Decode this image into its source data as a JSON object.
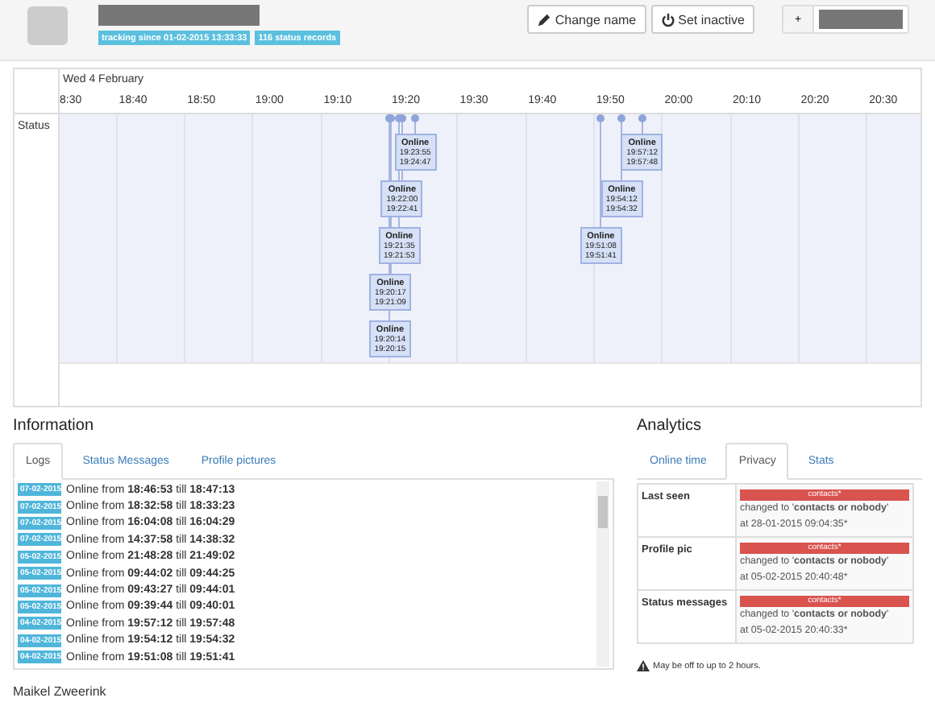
{
  "profile": {
    "badges": [
      "tracking since 01-02-2015 13:33:33",
      "116 status records"
    ],
    "buttons": [
      {
        "kind": "pencil",
        "label": "Change name"
      },
      {
        "kind": "power",
        "label": "Set inactive"
      }
    ],
    "add_button": "+"
  },
  "timeline": {
    "date": "Wed 4 February",
    "ticks": [
      "8:30",
      "18:40",
      "18:50",
      "19:00",
      "19:10",
      "19:20",
      "19:30",
      "19:40",
      "19:50",
      "20:00",
      "20:10",
      "20:20",
      "20:30"
    ],
    "row_label": "Status",
    "events": [
      {
        "status": "Online",
        "from": "19:23:55",
        "till": "19:24:47"
      },
      {
        "status": "Online",
        "from": "19:22:00",
        "till": "19:22:41"
      },
      {
        "status": "Online",
        "from": "19:21:35",
        "till": "19:21:53"
      },
      {
        "status": "Online",
        "from": "19:20:17",
        "till": "19:21:09"
      },
      {
        "status": "Online",
        "from": "19:20:14",
        "till": "19:20:15"
      },
      {
        "status": "Online",
        "from": "19:57:12",
        "till": "19:57:48"
      },
      {
        "status": "Online",
        "from": "19:54:12",
        "till": "19:54:32"
      },
      {
        "status": "Online",
        "from": "19:51:08",
        "till": "19:51:41"
      }
    ]
  },
  "information": {
    "title": "Information",
    "tabs": [
      {
        "label": "Logs",
        "selected": true
      },
      {
        "label": "Status Messages",
        "selected": false
      },
      {
        "label": "Profile pictures",
        "selected": false
      }
    ],
    "logs": [
      {
        "date": "07-02-2015",
        "text": "Online from **18:46:53** till **18:47:13**"
      },
      {
        "date": "07-02-2015",
        "text": "Online from **18:32:58** till **18:33:23**"
      },
      {
        "date": "07-02-2015",
        "text": "Online from **16:04:08** till **16:04:29**"
      },
      {
        "date": "07-02-2015",
        "text": "Online from **14:37:58** till **14:38:32**"
      },
      {
        "date": "05-02-2015",
        "text": "Online from **21:48:28** till **21:49:02**"
      },
      {
        "date": "05-02-2015",
        "text": "Online from **09:44:02** till **09:44:25**"
      },
      {
        "date": "05-02-2015",
        "text": "Online from **09:43:27** till **09:44:01**"
      },
      {
        "date": "05-02-2015",
        "text": "Online from **09:39:44** till **09:40:01**"
      },
      {
        "date": "04-02-2015",
        "text": "Online from **19:57:12** till **19:57:48**"
      },
      {
        "date": "04-02-2015",
        "text": "Online from **19:54:12** till **19:54:32**"
      },
      {
        "date": "04-02-2015",
        "text": "Online from **19:51:08** till **19:51:41**"
      }
    ],
    "footer": "Maikel Zweerink"
  },
  "analytics": {
    "title": "Analytics",
    "tabs": [
      {
        "label": "Online time",
        "selected": false
      },
      {
        "label": "Privacy",
        "selected": true
      },
      {
        "label": "Stats",
        "selected": false
      }
    ],
    "privacy": [
      {
        "label": "Last seen",
        "badge": "contacts*",
        "change": "changed to '**contacts or nobody**'",
        "time": "at 28-01-2015 09:04:35*"
      },
      {
        "label": "Profile pic",
        "badge": "contacts*",
        "change": "changed to '**contacts or nobody**'",
        "time": "at 05-02-2015 20:40:48*"
      },
      {
        "label": "Status messages",
        "badge": "contacts*",
        "change": "changed to '**contacts or nobody**'",
        "time": "at 05-02-2015 20:40:33*"
      }
    ],
    "note": "May be off to up to 2 hours."
  }
}
